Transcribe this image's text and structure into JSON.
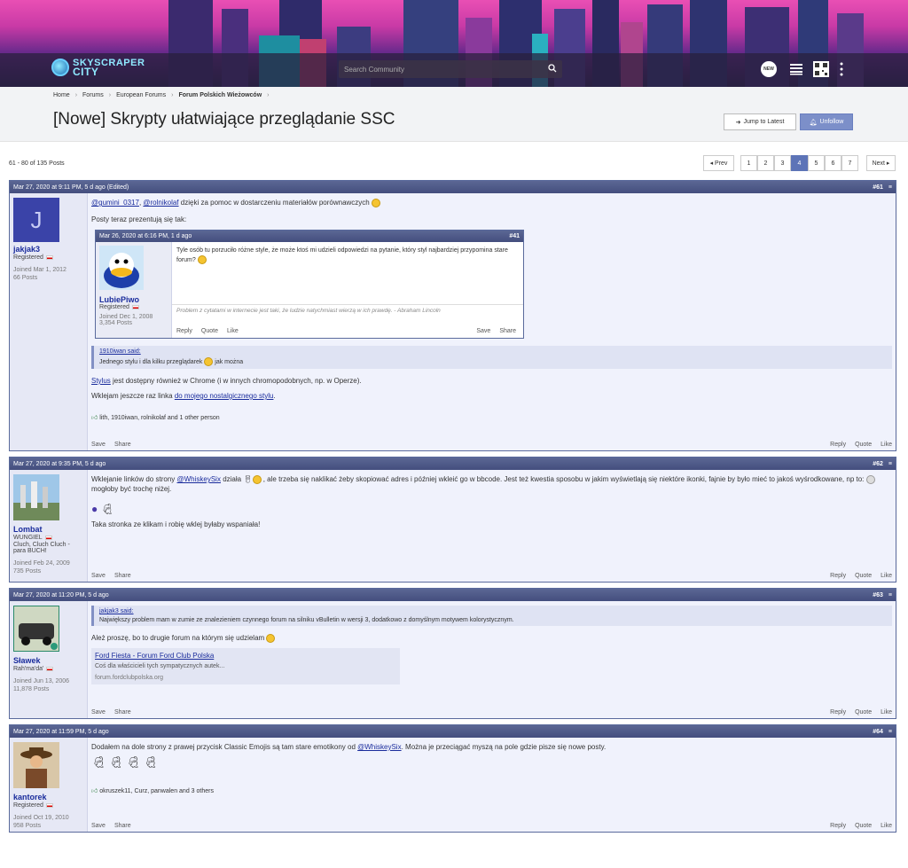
{
  "header": {
    "logo_text_1": "SKYSCRAPER",
    "logo_text_2": "CITY",
    "search_placeholder": "Search Community",
    "new_badge": "NEW"
  },
  "breadcrumb": [
    "Home",
    "Forums",
    "European Forums",
    "Forum Polskich Wieżowców"
  ],
  "page_title": "[Nowe] Skrypty ułatwiające przeglądanie SSC",
  "buttons": {
    "jump": "Jump to Latest",
    "unfollow": "Unfollow"
  },
  "post_count": "61 - 80 of 135 Posts",
  "pager": {
    "prev": "◂ Prev",
    "next": "Next ▸",
    "pages": [
      "1",
      "2",
      "3",
      "4",
      "5",
      "6",
      "7"
    ],
    "active": "4"
  },
  "actions": {
    "save": "Save",
    "share": "Share",
    "reply": "Reply",
    "quote": "Quote",
    "like": "Like"
  },
  "posts": [
    {
      "date": "Mar 27, 2020 at 9:11 PM, 5 d ago (Edited)",
      "num": "#61",
      "author": {
        "initial": "J",
        "name": "jakjak3",
        "role": "Registered",
        "joined": "Joined Mar 1, 2012",
        "posts": "66 Posts"
      },
      "mention1": "@gumini_0317",
      "mention2": "@rolnikolaf",
      "text1": "dzięki za pomoc w dostarczeniu materiałów porównawczych",
      "text2": "Posty teraz prezentują się tak:",
      "embed": {
        "date": "Mar 26, 2020 at 6:16 PM, 1 d ago",
        "num": "#41",
        "name": "LubiePiwo",
        "role": "Registered",
        "joined": "Joined Dec 1, 2008",
        "posts": "3,354 Posts",
        "text": "Tyle osób tu porzuciło różne style, że może ktoś mi udzieli odpowiedzi na pytanie, który styl najbardziej przypomina stare forum?",
        "signature": "Problem z cytatami w internecie jest taki, że ludzie natychmiast wierzą w ich prawdę. - Abraham Lincoln",
        "reply": "Reply",
        "quote": "Quote",
        "like": "Like",
        "save": "Save",
        "share": "Share"
      },
      "quote_head": "1910iwan said:",
      "quote_text": "Jednego stylu i dla kilku przeglądarek",
      "quote_tail": "jak można",
      "stylus_link": "Stylus",
      "text3": "jest dostępny również w Chrome (i w innych chromopodobnych, np. w Operze).",
      "text4": "Wklejam jeszcze raz linka",
      "text4_link": "do mojego nostalgicznego stylu",
      "likes": "lith, 1910iwan, rolnikolaf and 1 other person"
    },
    {
      "date": "Mar 27, 2020 at 9:35 PM, 5 d ago",
      "num": "#62",
      "author": {
        "name": "Lombat",
        "role": "WUNGIEL",
        "status": "Cluch, Cluch Cluch - para BUCH!",
        "joined": "Joined Feb 24, 2009",
        "posts": "735 Posts"
      },
      "text1": "Wklejanie linków do strony",
      "mention": "@WhiskeySix",
      "text2": "działa",
      "text3": ", ale trzeba się naklikać żeby skopiować adres i później wkleić go w bbcode. Jest też kwestia sposobu w jakim wyświetlają się niektóre ikonki, fajnie by było mieć to jakoś wyśrodkowane, np to:",
      "text4": "mogłoby być trochę niżej.",
      "text5": "Taka stronka ze klikam i robię wklej byłaby wspaniała!"
    },
    {
      "date": "Mar 27, 2020 at 11:20 PM, 5 d ago",
      "num": "#63",
      "author": {
        "name": "Sławek",
        "role": "Rah'ma'da'",
        "joined": "Joined Jun 13, 2006",
        "posts": "11,878 Posts"
      },
      "quote_head": "jakjak3 said:",
      "quote_text": "Największy problem mam w zumie ze znalezieniem czynnego forum na silniku vBulletin w wersji 3, dodatkowo z domyślnym motywem kolorystycznym.",
      "text1": "Ależ proszę, bo to drugie forum na którym się udzielam",
      "link_title": "Ford Fiesta - Forum Ford Club Polska",
      "link_desc": "Coś dla właścicieli tych sympatycznych autek...",
      "link_url": "forum.fordclubpolska.org"
    },
    {
      "date": "Mar 27, 2020 at 11:59 PM, 5 d ago",
      "num": "#64",
      "author": {
        "name": "kantorek",
        "role": "Registered",
        "joined": "Joined Oct 19, 2010",
        "posts": "958 Posts"
      },
      "text1": "Dodałem na dole strony z prawej przycisk Classic Emojis są tam stare emotikony od",
      "mention": "@WhiskeySix",
      "text2": ". Można je przeciągać myszą na pole gdzie pisze się nowe posty.",
      "likes": "okruszek11, Curz, panwalen and 3 others"
    }
  ]
}
